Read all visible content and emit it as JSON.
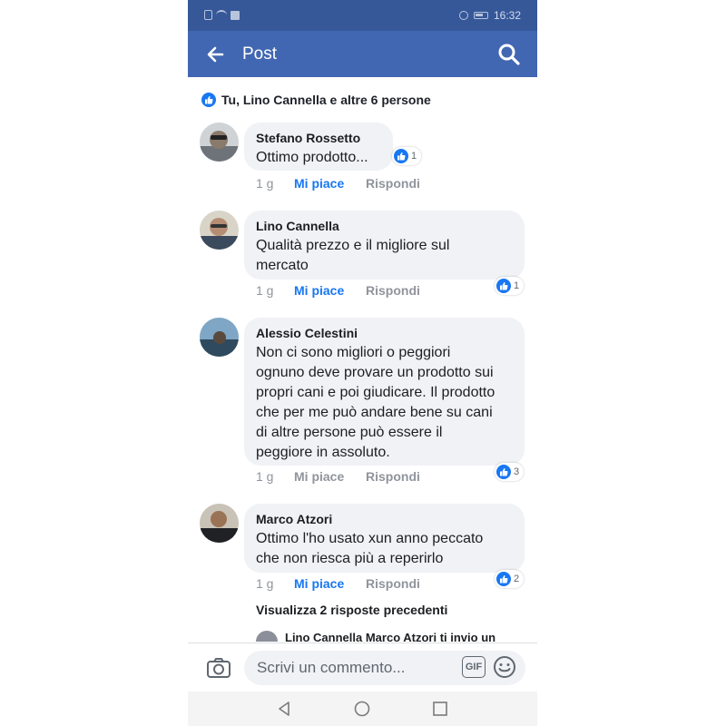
{
  "status_bar": {
    "time": "16:32",
    "icons": [
      "sim-icon",
      "wifi-icon",
      "facebook-icon",
      "alarm-icon",
      "battery-icon"
    ]
  },
  "app_bar": {
    "title": "Post",
    "left_icon": "back-arrow-icon",
    "right_icon": "search-icon"
  },
  "reactions_summary": "Tu, Lino Cannella e altre 6 persone",
  "comments": [
    {
      "author": "Stefano Rossetto",
      "text": "Ottimo prodotto...",
      "time": "1 g",
      "like_label": "Mi piace",
      "like_active": true,
      "reply_label": "Rispondi",
      "reactions": "1"
    },
    {
      "author": "Lino Cannella",
      "text_lines": [
        "Qualità prezzo e il migliore sul",
        "mercato"
      ],
      "time": "1 g",
      "like_label": "Mi piace",
      "like_active": true,
      "reply_label": "Rispondi",
      "reactions": "1"
    },
    {
      "author": "Alessio Celestini",
      "text_lines": [
        "Non ci sono migliori o peggiori",
        "ognuno deve provare un prodotto sui",
        "propri cani e poi giudicare. Il prodotto",
        "che per me può andare bene su cani",
        "di altre persone può essere il",
        "peggiore in assoluto."
      ],
      "time": "1 g",
      "like_label": "Mi piace",
      "like_active": false,
      "reply_label": "Rispondi",
      "reactions": "3"
    },
    {
      "author": "Marco Atzori",
      "text_lines": [
        "Ottimo l'ho usato xun anno peccato",
        "che non riesca più a reperirlo"
      ],
      "time": "1 g",
      "like_label": "Mi piace",
      "like_active": true,
      "reply_label": "Rispondi",
      "reactions": "2"
    }
  ],
  "previous_replies": "Visualizza 2 risposte precedenti",
  "partial_reply": "Lino Cannella Marco Atzori ti invio un",
  "composer": {
    "placeholder": "Scrivi un commento...",
    "gif_label": "GIF"
  },
  "colors": {
    "header": "#4267b2",
    "status": "#365899",
    "accent": "#1877f2",
    "bubble": "#f0f2f5"
  }
}
